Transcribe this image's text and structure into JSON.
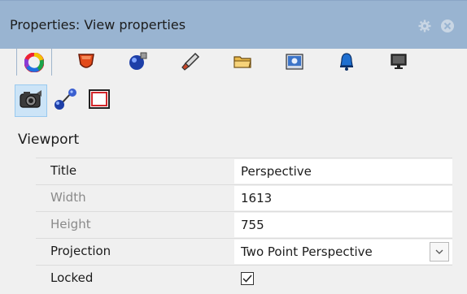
{
  "window": {
    "title": "Properties: View properties"
  },
  "titlebar_icons": [
    "gear-icon",
    "close-icon"
  ],
  "tabs": [
    {
      "name": "color-wheel-icon",
      "active": true
    },
    {
      "name": "material-icon",
      "active": false
    },
    {
      "name": "render-sphere-icon",
      "active": false
    },
    {
      "name": "brush-icon",
      "active": false
    },
    {
      "name": "folder-icon",
      "active": false
    },
    {
      "name": "image-icon",
      "active": false
    },
    {
      "name": "notification-bell-icon",
      "active": false
    },
    {
      "name": "display-icon",
      "active": false
    }
  ],
  "subtools": [
    {
      "name": "camera-icon",
      "active": true
    },
    {
      "name": "named-views-icon",
      "active": false
    },
    {
      "name": "viewport-frame-icon",
      "active": false
    }
  ],
  "section": {
    "title": "Viewport"
  },
  "properties": {
    "title": {
      "label": "Title",
      "value": "Perspective"
    },
    "width": {
      "label": "Width",
      "value": "1613"
    },
    "height": {
      "label": "Height",
      "value": "755"
    },
    "projection": {
      "label": "Projection",
      "value": "Two Point Perspective"
    },
    "locked": {
      "label": "Locked",
      "checked": true
    }
  },
  "colors": {
    "titlebar": "#99b4d1",
    "panel": "#f0f0f0",
    "active_subtool": "#cce4f7"
  }
}
